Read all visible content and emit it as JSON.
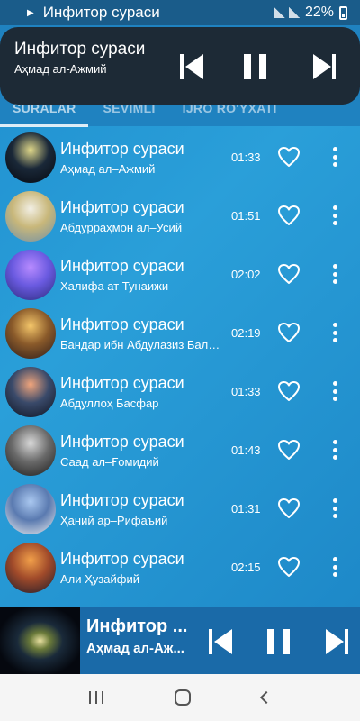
{
  "status_bar": {
    "title": "Инфитор сураси",
    "battery": "22%"
  },
  "tabs": [
    {
      "label": "SURALAR",
      "active": true
    },
    {
      "label": "SEVIMLI",
      "active": false
    },
    {
      "label": "IJRO RO'YXATI",
      "active": false
    }
  ],
  "notification_player": {
    "title": "Инфитор сураси",
    "artist": "Аҳмад ал-Ажмий"
  },
  "tracks": [
    {
      "title": "Инфитор сураси",
      "artist": "Аҳмад ал–Ажмий",
      "duration": "01:33",
      "thumb_colors": [
        "#e0d88a",
        "#1a2838",
        "#05080f"
      ]
    },
    {
      "title": "Инфитор сураси",
      "artist": "Абдурраҳмон ал–Усий",
      "duration": "01:51",
      "thumb_colors": [
        "#f2efe4",
        "#c8b77a",
        "#6f8fa8"
      ]
    },
    {
      "title": "Инфитор сураси",
      "artist": "Халифа ат Тунаижи",
      "duration": "02:02",
      "thumb_colors": [
        "#b88bff",
        "#6a5ae0",
        "#2a2a7a"
      ]
    },
    {
      "title": "Инфитор сураси",
      "artist": "Бандар ибн Абдулазиз Балийла",
      "duration": "02:19",
      "thumb_colors": [
        "#f4c66a",
        "#8a5a2a",
        "#2a1a1a"
      ]
    },
    {
      "title": "Инфитор сураси",
      "artist": "Абдуллоҳ Басфар",
      "duration": "01:33",
      "thumb_colors": [
        "#f1a57c",
        "#3a4a6a",
        "#0c1220"
      ]
    },
    {
      "title": "Инфитор сураси",
      "artist": "Саад ал–Ғомидий",
      "duration": "01:43",
      "thumb_colors": [
        "#d8d8d8",
        "#6a6a6a",
        "#1a1a1a"
      ]
    },
    {
      "title": "Инфитор сураси",
      "artist": "Ҳаний ар–Рифаъий",
      "duration": "01:31",
      "thumb_colors": [
        "#aac8f0",
        "#5a7ab0",
        "#f0f0f0"
      ]
    },
    {
      "title": "Инфитор сураси",
      "artist": "Али Ҳузайфий",
      "duration": "02:15",
      "thumb_colors": [
        "#f2a04a",
        "#a04a2a",
        "#1a1a2a"
      ]
    }
  ],
  "bottom_player": {
    "title": "Инфитор ...",
    "artist": "Аҳмад ал-Аж..."
  },
  "colors": {
    "accent": "#2a9fd9",
    "notification_bg": "#1d2a36",
    "bottom_bar_bg": "#1a6aa8"
  }
}
